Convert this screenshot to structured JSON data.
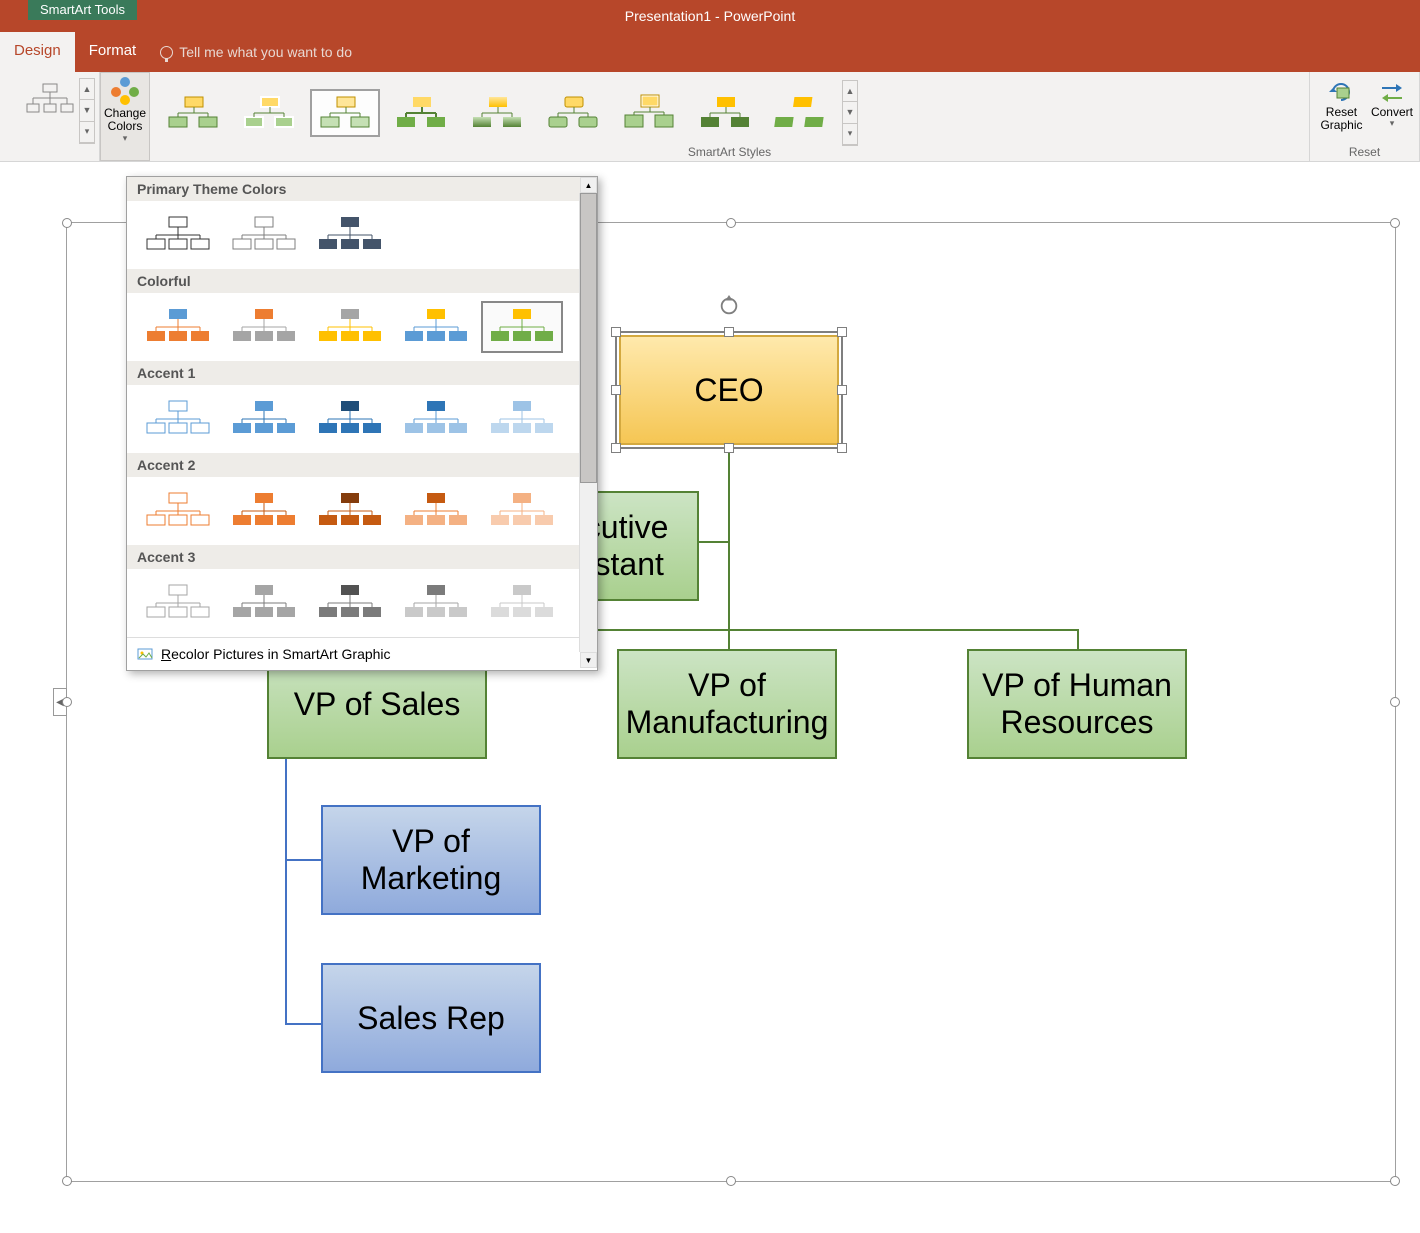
{
  "title": {
    "tools": "SmartArt Tools",
    "doc": "Presentation1",
    "sep": "  -  ",
    "app": "PowerPoint"
  },
  "tabs": {
    "design": "Design",
    "format": "Format",
    "tellme": "Tell me what you want to do"
  },
  "ribbon": {
    "changeColors": "Change Colors",
    "stylesLabel": "SmartArt Styles",
    "resetGraphic": "Reset Graphic",
    "convert": "Convert",
    "resetLabel": "Reset"
  },
  "colorPopup": {
    "sections": {
      "primary": "Primary Theme Colors",
      "colorful": "Colorful",
      "accent1": "Accent 1",
      "accent2": "Accent 2",
      "accent3": "Accent 3"
    },
    "recolor": {
      "prefix": "R",
      "rest": "ecolor Pictures in SmartArt Graphic"
    }
  },
  "org": {
    "ceo": "CEO",
    "exec": "Executive Assistant",
    "execVisible": "tive tant",
    "vpSales": "VP of Sales",
    "vpMfg": "VP of Manufacturing",
    "vpHR": "VP of Human Resources",
    "vpMkt": "VP of Marketing",
    "salesRep": "Sales Rep"
  }
}
